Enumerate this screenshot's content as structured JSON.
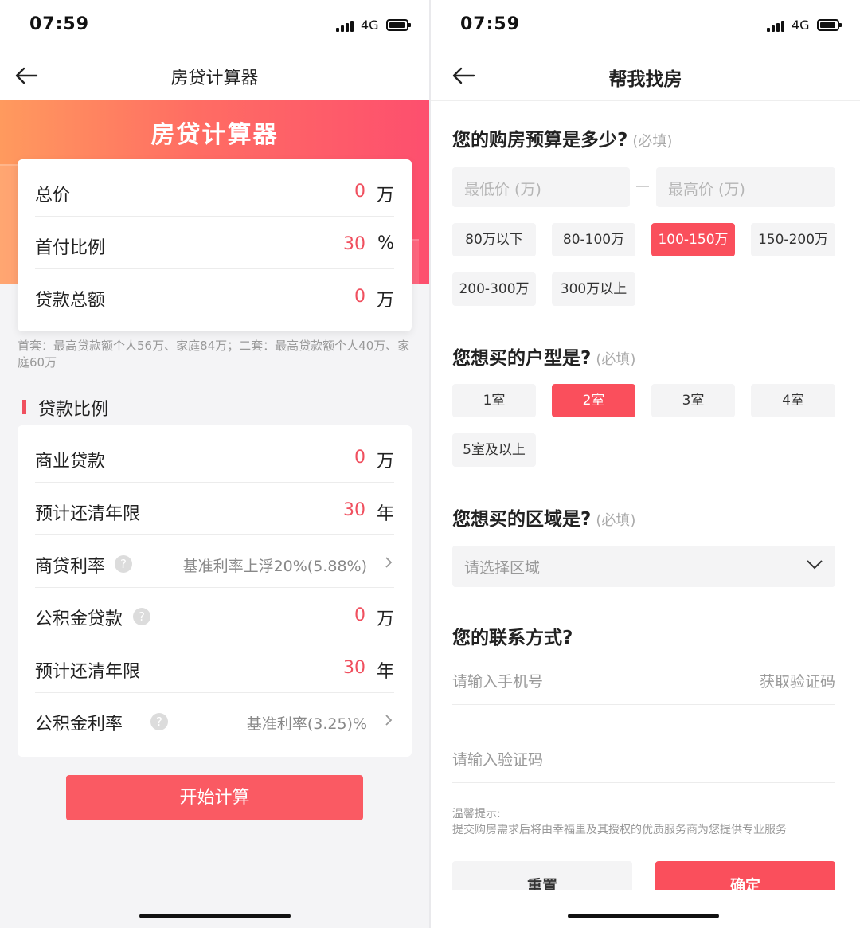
{
  "left": {
    "status": {
      "time": "07:59",
      "network": "4G"
    },
    "nav": {
      "title": "房贷计算器"
    },
    "banner": {
      "title": "房贷计算器"
    },
    "summary": [
      {
        "label": "总价",
        "value": "0",
        "unit": "万"
      },
      {
        "label": "首付比例",
        "value": "30",
        "unit": "%"
      },
      {
        "label": "贷款总额",
        "value": "0",
        "unit": "万"
      }
    ],
    "note": "首套：最高贷款额个人56万、家庭84万；二套：最高贷款额个人40万、家庭60万",
    "section_title": "贷款比例",
    "loan": {
      "commercial": {
        "label": "商业贷款",
        "value": "0",
        "unit": "万"
      },
      "commercial_years": {
        "label": "预计还清年限",
        "value": "30",
        "unit": "年"
      },
      "commercial_rate": {
        "label": "商贷利率",
        "value": "基准利率上浮20%(5.88%)"
      },
      "fund": {
        "label": "公积金贷款",
        "value": "0",
        "unit": "万"
      },
      "fund_years": {
        "label": "预计还清年限",
        "value": "30",
        "unit": "年"
      },
      "fund_rate": {
        "label": "公积金利率",
        "value": "基准利率(3.25)%"
      }
    },
    "calc_button": "开始计算",
    "help_glyph": "?"
  },
  "right": {
    "status": {
      "time": "07:59",
      "network": "4G"
    },
    "nav": {
      "title": "帮我找房"
    },
    "budget": {
      "question": "您的购房预算是多少?",
      "required": "(必填)",
      "min_placeholder": "最低价 (万)",
      "max_placeholder": "最高价 (万)",
      "options": [
        "80万以下",
        "80-100万",
        "100-150万",
        "150-200万",
        "200-300万",
        "300万以上"
      ],
      "selected": "100-150万"
    },
    "layout": {
      "question": "您想买的户型是?",
      "required": "(必填)",
      "options": [
        "1室",
        "2室",
        "3室",
        "4室",
        "5室及以上"
      ],
      "selected": "2室"
    },
    "area": {
      "question": "您想买的区域是?",
      "required": "(必填)",
      "placeholder": "请选择区域"
    },
    "contact": {
      "question": "您的联系方式?",
      "phone_placeholder": "请输入手机号",
      "get_code": "获取验证码",
      "code_placeholder": "请输入验证码"
    },
    "tip": {
      "title": "温馨提示:",
      "text": "提交购房需求后将由幸福里及其授权的优质服务商为您提供专业服务"
    },
    "buttons": {
      "reset": "重置",
      "confirm": "确定"
    }
  },
  "colors": {
    "accent": "#fa4f5c",
    "value_red": "#f0505f",
    "banner_start": "#ff9a5e",
    "banner_end": "#fd4f6e"
  }
}
